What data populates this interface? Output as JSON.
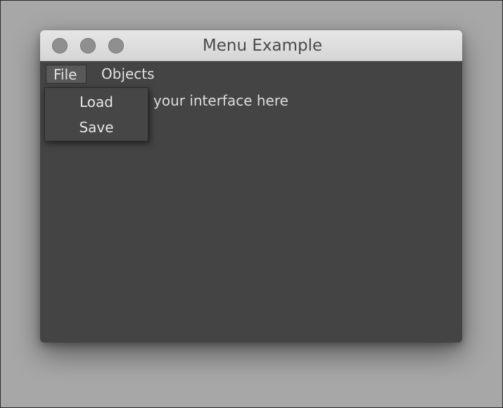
{
  "window": {
    "title": "Menu Example"
  },
  "menubar": {
    "items": [
      {
        "label": "File"
      },
      {
        "label": "Objects"
      }
    ]
  },
  "dropdown": {
    "items": [
      {
        "label": "Load"
      },
      {
        "label": "Save"
      }
    ]
  },
  "content": {
    "visible_text": "your interface here"
  },
  "colors": {
    "desktop_bg": "#a7a7a7",
    "window_bg": "#444444",
    "titlebar_bg": "#dcdcdc",
    "text_light": "#e2e2e2"
  }
}
